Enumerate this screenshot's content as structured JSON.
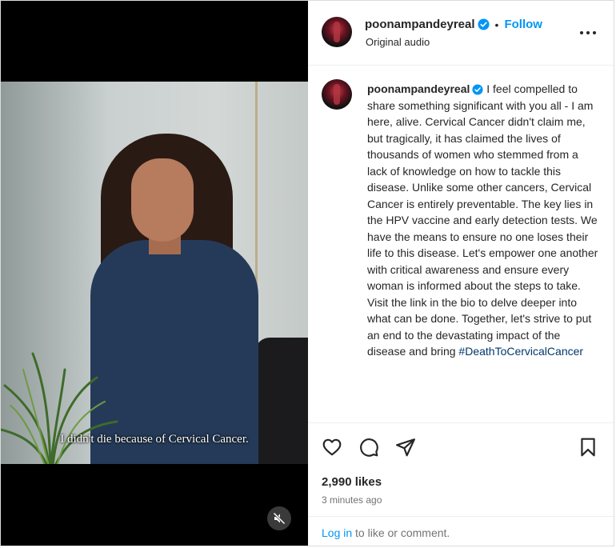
{
  "video": {
    "caption": "I didn't die because of Cervical Cancer.",
    "mute_icon": "speaker-muted-icon"
  },
  "header": {
    "username": "poonampandeyreal",
    "verified_icon": "verified-badge-icon",
    "separator": "•",
    "follow_label": "Follow",
    "subtitle": "Original audio",
    "more_icon": "more-options-icon"
  },
  "comment": {
    "username": "poonampandeyreal",
    "text": "I feel compelled to share something significant with you all - I am here, alive. Cervical Cancer didn't claim me, but tragically, it has claimed the lives of thousands of women who stemmed from a lack of knowledge on how to tackle this disease. Unlike some other cancers, Cervical Cancer is entirely preventable. The key lies in the HPV vaccine and early detection tests. We have the means to ensure no one loses their life to this disease. Let's empower one another with critical awareness and ensure every woman is informed about the steps to take. Visit the link in the bio to delve deeper into what can be done. Together, let's strive to put an end to the devastating impact of the disease and bring",
    "hashtag": "#DeathToCervicalCancer"
  },
  "actions": {
    "icons": [
      "heart-icon",
      "comment-icon",
      "share-icon",
      "bookmark-icon"
    ],
    "likes": "2,990 likes",
    "time": "3 minutes ago",
    "login_link": "Log in",
    "login_rest": "to like or comment."
  },
  "colors": {
    "accent": "#0095f6",
    "hashtag": "#00376b",
    "muted_text": "#737373"
  }
}
